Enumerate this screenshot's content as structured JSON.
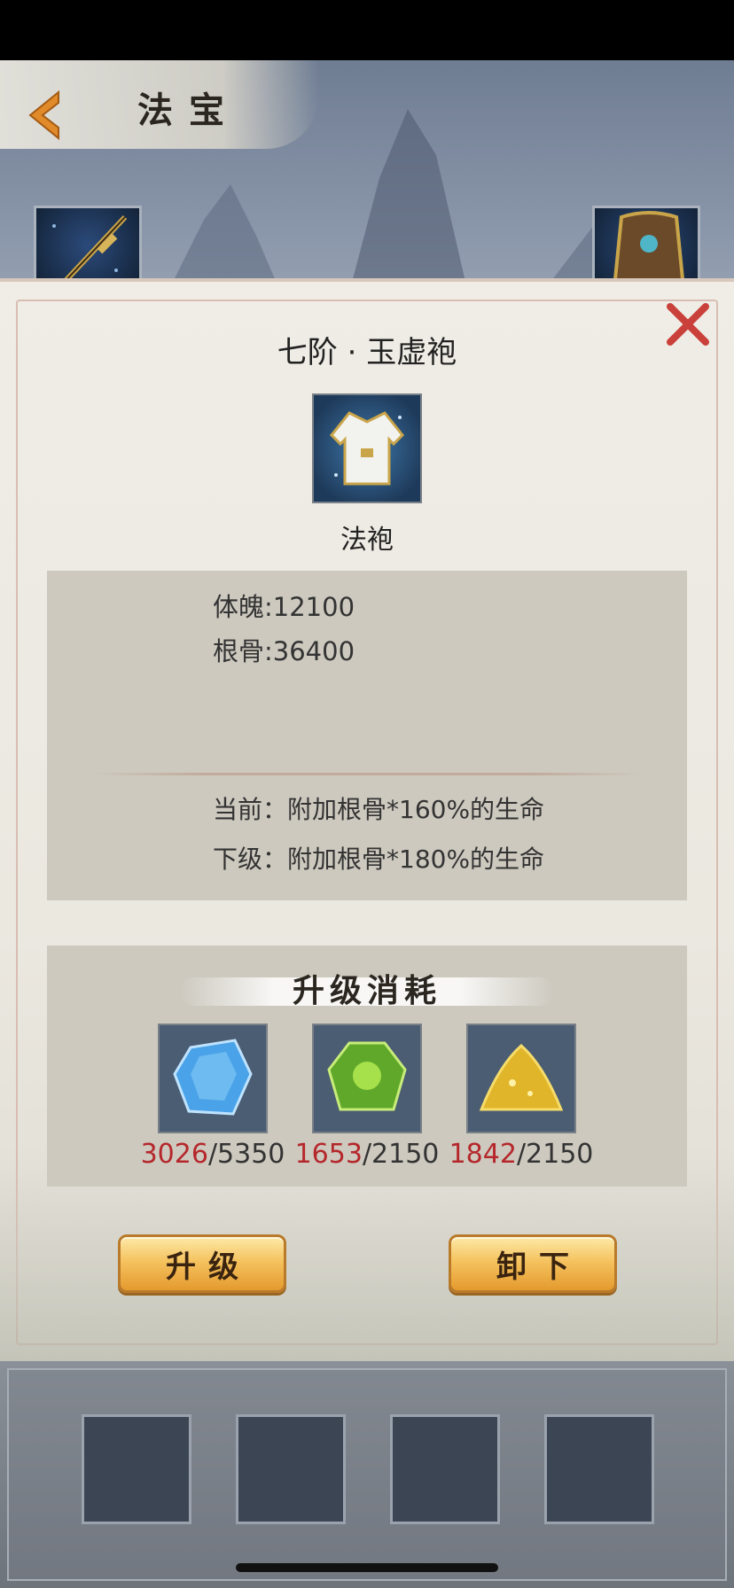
{
  "header": {
    "title": "法宝"
  },
  "item": {
    "name": "七阶 · 玉虚袍",
    "type": "法袍"
  },
  "stats": [
    {
      "text": "体魄:12100"
    },
    {
      "text": "根骨:36400"
    }
  ],
  "effects": {
    "current": "当前：附加根骨*160%的生命",
    "next": "下级：附加根骨*180%的生命"
  },
  "cost": {
    "title": "升级消耗",
    "materials": [
      {
        "icon": "blue-crystal-icon",
        "have": "3026",
        "need": "/5350"
      },
      {
        "icon": "green-gem-icon",
        "have": "1653",
        "need": "/2150"
      },
      {
        "icon": "gold-ore-icon",
        "have": "1842",
        "need": "/2150"
      }
    ]
  },
  "buttons": {
    "upgrade": "升级",
    "unequip": "卸下"
  },
  "colors": {
    "insufficient": "#b5272b",
    "button_gold": "#f5c35f"
  }
}
